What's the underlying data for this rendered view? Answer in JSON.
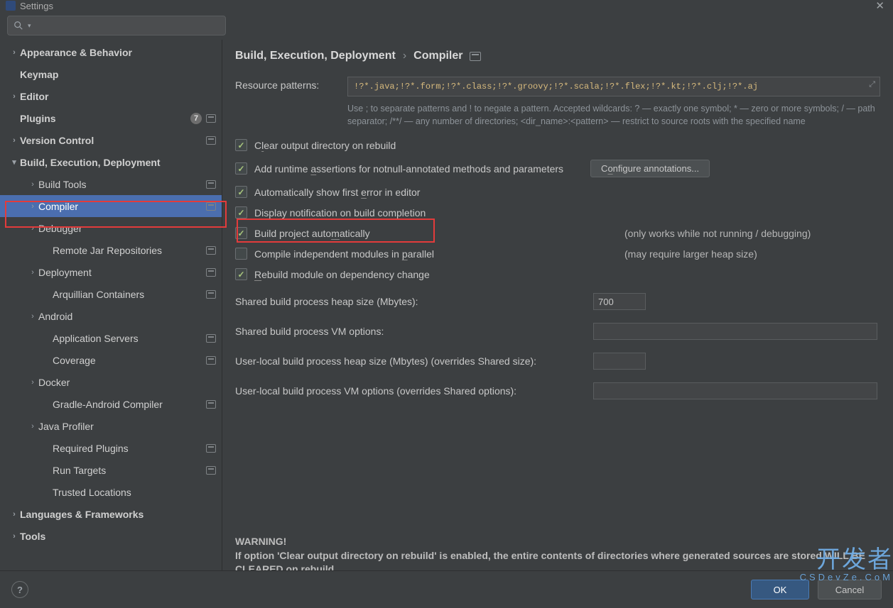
{
  "window": {
    "title": "Settings"
  },
  "search": {
    "placeholder": ""
  },
  "sidebar": {
    "items": [
      {
        "label": "Appearance & Behavior",
        "depth": 0,
        "chev": "right",
        "meta": false
      },
      {
        "label": "Keymap",
        "depth": 0,
        "chev": "",
        "meta": false
      },
      {
        "label": "Editor",
        "depth": 0,
        "chev": "right",
        "meta": false
      },
      {
        "label": "Plugins",
        "depth": 0,
        "chev": "",
        "meta": true,
        "badge": "7"
      },
      {
        "label": "Version Control",
        "depth": 0,
        "chev": "right",
        "meta": true
      },
      {
        "label": "Build, Execution, Deployment",
        "depth": 0,
        "chev": "down",
        "meta": false
      },
      {
        "label": "Build Tools",
        "depth": 1,
        "chev": "right",
        "meta": true
      },
      {
        "label": "Compiler",
        "depth": 1,
        "chev": "right",
        "meta": true,
        "selected": true
      },
      {
        "label": "Debugger",
        "depth": 1,
        "chev": "right",
        "meta": false
      },
      {
        "label": "Remote Jar Repositories",
        "depth": 2,
        "chev": "",
        "meta": true
      },
      {
        "label": "Deployment",
        "depth": 1,
        "chev": "right",
        "meta": true
      },
      {
        "label": "Arquillian Containers",
        "depth": 2,
        "chev": "",
        "meta": true
      },
      {
        "label": "Android",
        "depth": 1,
        "chev": "right",
        "meta": false
      },
      {
        "label": "Application Servers",
        "depth": 2,
        "chev": "",
        "meta": true
      },
      {
        "label": "Coverage",
        "depth": 2,
        "chev": "",
        "meta": true
      },
      {
        "label": "Docker",
        "depth": 1,
        "chev": "right",
        "meta": false
      },
      {
        "label": "Gradle-Android Compiler",
        "depth": 2,
        "chev": "",
        "meta": true
      },
      {
        "label": "Java Profiler",
        "depth": 1,
        "chev": "right",
        "meta": false
      },
      {
        "label": "Required Plugins",
        "depth": 2,
        "chev": "",
        "meta": true
      },
      {
        "label": "Run Targets",
        "depth": 2,
        "chev": "",
        "meta": true
      },
      {
        "label": "Trusted Locations",
        "depth": 2,
        "chev": "",
        "meta": false
      },
      {
        "label": "Languages & Frameworks",
        "depth": 0,
        "chev": "right",
        "meta": false
      },
      {
        "label": "Tools",
        "depth": 0,
        "chev": "right",
        "meta": false
      }
    ]
  },
  "breadcrumb": {
    "a": "Build, Execution, Deployment",
    "b": "Compiler"
  },
  "resource": {
    "label": "Resource patterns:",
    "value": "!?*.java;!?*.form;!?*.class;!?*.groovy;!?*.scala;!?*.flex;!?*.kt;!?*.clj;!?*.aj",
    "help1": "Use ; to separate patterns and ! to negate a pattern. Accepted wildcards: ? — exactly one symbol; * — zero or more symbols; / — path separator; /**/ — any number of directories; <dir_name>:<pattern> — restrict to source roots with the specified name"
  },
  "checks": {
    "clear": {
      "label_pre": "C",
      "label_u": "l",
      "label_post": "ear output directory on rebuild",
      "checked": true
    },
    "runtime": {
      "label_pre": "Add runtime ",
      "label_u": "a",
      "label_post": "ssertions for notnull-annotated methods and parameters",
      "checked": true
    },
    "firstErr": {
      "label_pre": "Automatically show first ",
      "label_u": "e",
      "label_post": "rror in editor",
      "checked": true
    },
    "notify": {
      "label_pre": "",
      "label_u": "D",
      "label_post": "isplay notification on build completion",
      "checked": true
    },
    "autoBuild": {
      "label_pre": "Build project auto",
      "label_u": "m",
      "label_post": "atically",
      "checked": true,
      "note": "(only works while not running / debugging)"
    },
    "parallel": {
      "label_pre": "Compile independent modules in ",
      "label_u": "p",
      "label_post": "arallel",
      "checked": false,
      "note": "(may require larger heap size)"
    },
    "rebuildDep": {
      "label_pre": "",
      "label_u": "R",
      "label_post": "ebuild module on dependency change",
      "checked": true
    }
  },
  "configureBtn": {
    "pre": "C",
    "u": "o",
    "post": "nfigure annotations..."
  },
  "fields": {
    "sharedHeap": {
      "label": "Shared build process heap size (Mbytes):",
      "value": "700"
    },
    "sharedVm": {
      "label": "Shared build process VM options:",
      "value": ""
    },
    "userHeap": {
      "label": "User-local build process heap size (Mbytes) (overrides Shared size):",
      "value": ""
    },
    "userVm": {
      "label": "User-local build process VM options (overrides Shared options):",
      "value": ""
    }
  },
  "warning": {
    "title": "WARNING!",
    "body": "If option 'Clear output directory on rebuild' is enabled, the entire contents of directories where generated sources are stored WILL BE CLEARED on rebuild."
  },
  "buttons": {
    "ok": "OK",
    "cancel": "Cancel"
  },
  "watermark": {
    "main": "开发者",
    "sub": "CSDevZe.CoM"
  }
}
